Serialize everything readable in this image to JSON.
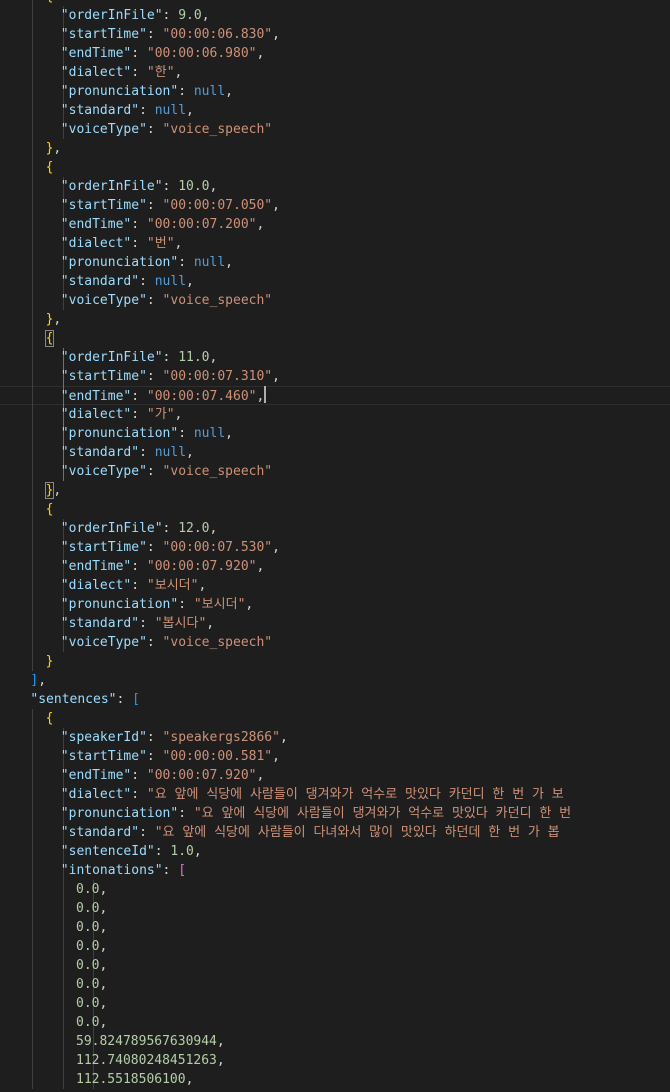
{
  "editor": {
    "language": "json",
    "colors": {
      "background": "#1e1e1e",
      "key": "#9cdcfe",
      "string": "#ce9178",
      "number": "#b5cea8",
      "keyword": "#569cd6",
      "bracket_level_1": "#ffd700",
      "bracket_level_2": "#da70d6",
      "bracket_level_3": "#179fff"
    },
    "lines": [
      {
        "indent": 6,
        "tokens": [
          [
            "b0",
            "{"
          ]
        ]
      },
      {
        "indent": 8,
        "tokens": [
          [
            "key",
            "\"orderInFile\""
          ],
          [
            "punc",
            ": "
          ],
          [
            "num",
            "9.0"
          ],
          [
            "punc",
            ","
          ]
        ]
      },
      {
        "indent": 8,
        "tokens": [
          [
            "key",
            "\"startTime\""
          ],
          [
            "punc",
            ": "
          ],
          [
            "str",
            "\"00:00:06.830\""
          ],
          [
            "punc",
            ","
          ]
        ]
      },
      {
        "indent": 8,
        "tokens": [
          [
            "key",
            "\"endTime\""
          ],
          [
            "punc",
            ": "
          ],
          [
            "str",
            "\"00:00:06.980\""
          ],
          [
            "punc",
            ","
          ]
        ]
      },
      {
        "indent": 8,
        "tokens": [
          [
            "key",
            "\"dialect\""
          ],
          [
            "punc",
            ": "
          ],
          [
            "str",
            "\"한\""
          ],
          [
            "punc",
            ","
          ]
        ]
      },
      {
        "indent": 8,
        "tokens": [
          [
            "key",
            "\"pronunciation\""
          ],
          [
            "punc",
            ": "
          ],
          [
            "kw",
            "null"
          ],
          [
            "punc",
            ","
          ]
        ]
      },
      {
        "indent": 8,
        "tokens": [
          [
            "key",
            "\"standard\""
          ],
          [
            "punc",
            ": "
          ],
          [
            "kw",
            "null"
          ],
          [
            "punc",
            ","
          ]
        ]
      },
      {
        "indent": 8,
        "tokens": [
          [
            "key",
            "\"voiceType\""
          ],
          [
            "punc",
            ": "
          ],
          [
            "str",
            "\"voice_speech\""
          ]
        ]
      },
      {
        "indent": 6,
        "tokens": [
          [
            "b0",
            "}"
          ],
          [
            "punc",
            ","
          ]
        ]
      },
      {
        "indent": 6,
        "tokens": [
          [
            "b0",
            "{"
          ]
        ]
      },
      {
        "indent": 8,
        "tokens": [
          [
            "key",
            "\"orderInFile\""
          ],
          [
            "punc",
            ": "
          ],
          [
            "num",
            "10.0"
          ],
          [
            "punc",
            ","
          ]
        ]
      },
      {
        "indent": 8,
        "tokens": [
          [
            "key",
            "\"startTime\""
          ],
          [
            "punc",
            ": "
          ],
          [
            "str",
            "\"00:00:07.050\""
          ],
          [
            "punc",
            ","
          ]
        ]
      },
      {
        "indent": 8,
        "tokens": [
          [
            "key",
            "\"endTime\""
          ],
          [
            "punc",
            ": "
          ],
          [
            "str",
            "\"00:00:07.200\""
          ],
          [
            "punc",
            ","
          ]
        ]
      },
      {
        "indent": 8,
        "tokens": [
          [
            "key",
            "\"dialect\""
          ],
          [
            "punc",
            ": "
          ],
          [
            "str",
            "\"번\""
          ],
          [
            "punc",
            ","
          ]
        ]
      },
      {
        "indent": 8,
        "tokens": [
          [
            "key",
            "\"pronunciation\""
          ],
          [
            "punc",
            ": "
          ],
          [
            "kw",
            "null"
          ],
          [
            "punc",
            ","
          ]
        ]
      },
      {
        "indent": 8,
        "tokens": [
          [
            "key",
            "\"standard\""
          ],
          [
            "punc",
            ": "
          ],
          [
            "kw",
            "null"
          ],
          [
            "punc",
            ","
          ]
        ]
      },
      {
        "indent": 8,
        "tokens": [
          [
            "key",
            "\"voiceType\""
          ],
          [
            "punc",
            ": "
          ],
          [
            "str",
            "\"voice_speech\""
          ]
        ]
      },
      {
        "indent": 6,
        "tokens": [
          [
            "b0",
            "}"
          ],
          [
            "punc",
            ","
          ]
        ]
      },
      {
        "indent": 6,
        "tokens": [
          [
            "b0",
            "{",
            "match"
          ]
        ]
      },
      {
        "indent": 8,
        "tokens": [
          [
            "key",
            "\"orderInFile\""
          ],
          [
            "punc",
            ": "
          ],
          [
            "num",
            "11.0"
          ],
          [
            "punc",
            ","
          ]
        ]
      },
      {
        "indent": 8,
        "tokens": [
          [
            "key",
            "\"startTime\""
          ],
          [
            "punc",
            ": "
          ],
          [
            "str",
            "\"00:00:07.310\""
          ],
          [
            "punc",
            ","
          ]
        ]
      },
      {
        "indent": 8,
        "current": true,
        "cursor": true,
        "tokens": [
          [
            "key",
            "\"endTime\""
          ],
          [
            "punc",
            ": "
          ],
          [
            "str",
            "\"00:00:07.460\""
          ],
          [
            "punc",
            ","
          ]
        ]
      },
      {
        "indent": 8,
        "tokens": [
          [
            "key",
            "\"dialect\""
          ],
          [
            "punc",
            ": "
          ],
          [
            "str",
            "\"가\""
          ],
          [
            "punc",
            ","
          ]
        ]
      },
      {
        "indent": 8,
        "tokens": [
          [
            "key",
            "\"pronunciation\""
          ],
          [
            "punc",
            ": "
          ],
          [
            "kw",
            "null"
          ],
          [
            "punc",
            ","
          ]
        ]
      },
      {
        "indent": 8,
        "tokens": [
          [
            "key",
            "\"standard\""
          ],
          [
            "punc",
            ": "
          ],
          [
            "kw",
            "null"
          ],
          [
            "punc",
            ","
          ]
        ]
      },
      {
        "indent": 8,
        "tokens": [
          [
            "key",
            "\"voiceType\""
          ],
          [
            "punc",
            ": "
          ],
          [
            "str",
            "\"voice_speech\""
          ]
        ]
      },
      {
        "indent": 6,
        "tokens": [
          [
            "b0",
            "}",
            "match"
          ],
          [
            "punc",
            ","
          ]
        ]
      },
      {
        "indent": 6,
        "tokens": [
          [
            "b0",
            "{"
          ]
        ]
      },
      {
        "indent": 8,
        "tokens": [
          [
            "key",
            "\"orderInFile\""
          ],
          [
            "punc",
            ": "
          ],
          [
            "num",
            "12.0"
          ],
          [
            "punc",
            ","
          ]
        ]
      },
      {
        "indent": 8,
        "tokens": [
          [
            "key",
            "\"startTime\""
          ],
          [
            "punc",
            ": "
          ],
          [
            "str",
            "\"00:00:07.530\""
          ],
          [
            "punc",
            ","
          ]
        ]
      },
      {
        "indent": 8,
        "tokens": [
          [
            "key",
            "\"endTime\""
          ],
          [
            "punc",
            ": "
          ],
          [
            "str",
            "\"00:00:07.920\""
          ],
          [
            "punc",
            ","
          ]
        ]
      },
      {
        "indent": 8,
        "tokens": [
          [
            "key",
            "\"dialect\""
          ],
          [
            "punc",
            ": "
          ],
          [
            "str",
            "\"보시더\""
          ],
          [
            "punc",
            ","
          ]
        ]
      },
      {
        "indent": 8,
        "tokens": [
          [
            "key",
            "\"pronunciation\""
          ],
          [
            "punc",
            ": "
          ],
          [
            "str",
            "\"보시더\""
          ],
          [
            "punc",
            ","
          ]
        ]
      },
      {
        "indent": 8,
        "tokens": [
          [
            "key",
            "\"standard\""
          ],
          [
            "punc",
            ": "
          ],
          [
            "str",
            "\"봅시다\""
          ],
          [
            "punc",
            ","
          ]
        ]
      },
      {
        "indent": 8,
        "tokens": [
          [
            "key",
            "\"voiceType\""
          ],
          [
            "punc",
            ": "
          ],
          [
            "str",
            "\"voice_speech\""
          ]
        ]
      },
      {
        "indent": 6,
        "tokens": [
          [
            "b0",
            "}"
          ]
        ]
      },
      {
        "indent": 4,
        "tokens": [
          [
            "b2",
            "]"
          ],
          [
            "punc",
            ","
          ]
        ]
      },
      {
        "indent": 4,
        "tokens": [
          [
            "key",
            "\"sentences\""
          ],
          [
            "punc",
            ": "
          ],
          [
            "b2",
            "["
          ]
        ]
      },
      {
        "indent": 6,
        "tokens": [
          [
            "b0",
            "{"
          ]
        ]
      },
      {
        "indent": 8,
        "tokens": [
          [
            "key",
            "\"speakerId\""
          ],
          [
            "punc",
            ": "
          ],
          [
            "str",
            "\"speakergs2866\""
          ],
          [
            "punc",
            ","
          ]
        ]
      },
      {
        "indent": 8,
        "tokens": [
          [
            "key",
            "\"startTime\""
          ],
          [
            "punc",
            ": "
          ],
          [
            "str",
            "\"00:00:00.581\""
          ],
          [
            "punc",
            ","
          ]
        ]
      },
      {
        "indent": 8,
        "tokens": [
          [
            "key",
            "\"endTime\""
          ],
          [
            "punc",
            ": "
          ],
          [
            "str",
            "\"00:00:07.920\""
          ],
          [
            "punc",
            ","
          ]
        ]
      },
      {
        "indent": 8,
        "tokens": [
          [
            "key",
            "\"dialect\""
          ],
          [
            "punc",
            ": "
          ],
          [
            "str",
            "\"요 앞에 식당에 사람들이 댕겨와가 억수로 맛있다 카던디 한 번 가 보"
          ]
        ]
      },
      {
        "indent": 8,
        "tokens": [
          [
            "key",
            "\"pronunciation\""
          ],
          [
            "punc",
            ": "
          ],
          [
            "str",
            "\"요 앞에 식당에 사람들이 댕겨와가 억수로 맛있다 카던디 한 번"
          ]
        ]
      },
      {
        "indent": 8,
        "tokens": [
          [
            "key",
            "\"standard\""
          ],
          [
            "punc",
            ": "
          ],
          [
            "str",
            "\"요 앞에 식당에 사람들이 다녀와서 많이 맛있다 하던데 한 번 가 봅"
          ]
        ]
      },
      {
        "indent": 8,
        "tokens": [
          [
            "key",
            "\"sentenceId\""
          ],
          [
            "punc",
            ": "
          ],
          [
            "num",
            "1.0"
          ],
          [
            "punc",
            ","
          ]
        ]
      },
      {
        "indent": 8,
        "tokens": [
          [
            "key",
            "\"intonations\""
          ],
          [
            "punc",
            ": "
          ],
          [
            "b1",
            "["
          ]
        ]
      },
      {
        "indent": 10,
        "tokens": [
          [
            "num",
            "0.0"
          ],
          [
            "punc",
            ","
          ]
        ]
      },
      {
        "indent": 10,
        "tokens": [
          [
            "num",
            "0.0"
          ],
          [
            "punc",
            ","
          ]
        ]
      },
      {
        "indent": 10,
        "tokens": [
          [
            "num",
            "0.0"
          ],
          [
            "punc",
            ","
          ]
        ]
      },
      {
        "indent": 10,
        "tokens": [
          [
            "num",
            "0.0"
          ],
          [
            "punc",
            ","
          ]
        ]
      },
      {
        "indent": 10,
        "tokens": [
          [
            "num",
            "0.0"
          ],
          [
            "punc",
            ","
          ]
        ]
      },
      {
        "indent": 10,
        "tokens": [
          [
            "num",
            "0.0"
          ],
          [
            "punc",
            ","
          ]
        ]
      },
      {
        "indent": 10,
        "tokens": [
          [
            "num",
            "0.0"
          ],
          [
            "punc",
            ","
          ]
        ]
      },
      {
        "indent": 10,
        "tokens": [
          [
            "num",
            "0.0"
          ],
          [
            "punc",
            ","
          ]
        ]
      },
      {
        "indent": 10,
        "tokens": [
          [
            "num",
            "59.824789567630944"
          ],
          [
            "punc",
            ","
          ]
        ]
      },
      {
        "indent": 10,
        "tokens": [
          [
            "num",
            "112.74080248451263"
          ],
          [
            "punc",
            ","
          ]
        ]
      },
      {
        "indent": 10,
        "tokens": [
          [
            "num",
            "112.5518506100"
          ],
          [
            "punc",
            ","
          ]
        ]
      }
    ]
  }
}
